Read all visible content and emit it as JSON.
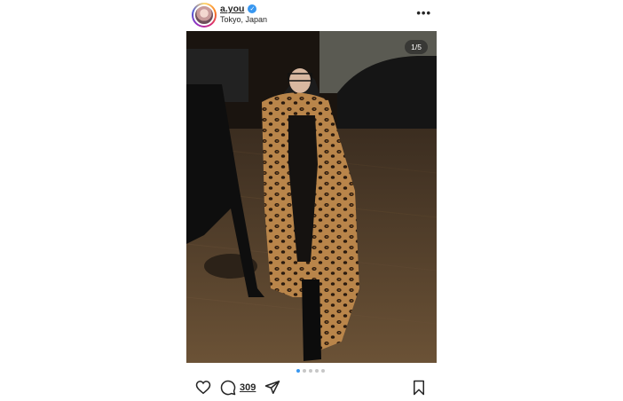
{
  "post": {
    "username": "a.you",
    "location": "Tokyo, Japan",
    "more_icon": "more-horizontal-icon",
    "verified_icon": "verified-badge-icon",
    "carousel_counter": "1/5",
    "carousel_total": 5,
    "carousel_current": 1,
    "comment_count": "309"
  },
  "actions": {
    "like_icon": "heart-icon",
    "comment_icon": "comment-icon",
    "share_icon": "send-icon",
    "save_icon": "bookmark-icon"
  },
  "colors": {
    "accent": "#3897f0",
    "text": "#262626"
  }
}
